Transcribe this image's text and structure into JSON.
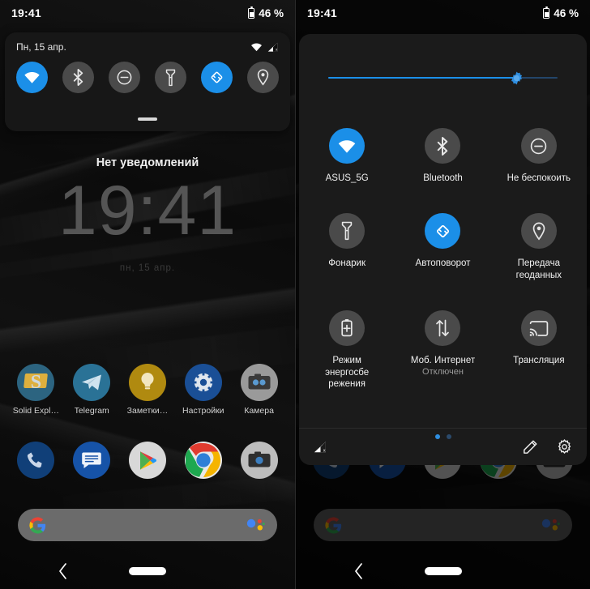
{
  "meta": {
    "os": "Android",
    "screen_title": "Android quick settings — collapsed (left) and expanded (right)",
    "accent_color": "#1b8fe8",
    "tile_off_color": "#4a4a4a",
    "panel_bg": "#1b1b1b"
  },
  "status_bar": {
    "time": "19:41",
    "battery_percent": "46 %",
    "battery_icon": "battery-icon"
  },
  "left_panel": {
    "shade": {
      "date": "Пн, 15 апр.",
      "wifi_icon": "wifi-icon",
      "signal_icon": "cellular-signal-off-icon",
      "handle": "drag-handle",
      "quick_tiles": [
        {
          "name": "wifi",
          "icon": "wifi-icon",
          "state": "on"
        },
        {
          "name": "bluetooth",
          "icon": "bluetooth-icon",
          "state": "off"
        },
        {
          "name": "do-not-disturb",
          "icon": "do-not-disturb-icon",
          "state": "off"
        },
        {
          "name": "flashlight",
          "icon": "flashlight-icon",
          "state": "off"
        },
        {
          "name": "auto-rotate",
          "icon": "auto-rotate-icon",
          "state": "on"
        },
        {
          "name": "location",
          "icon": "location-pin-icon",
          "state": "off"
        }
      ]
    },
    "lockscreen": {
      "no_notifications": "Нет уведомлений",
      "clock": "19:41",
      "date": "пн, 15 апр."
    },
    "home": {
      "apps_row1": [
        {
          "label": "Solid Expl…",
          "icon": "solid-explorer-icon"
        },
        {
          "label": "Telegram",
          "icon": "telegram-icon"
        },
        {
          "label": "Заметки…",
          "icon": "keep-notes-icon"
        },
        {
          "label": "Настройки",
          "icon": "settings-icon"
        },
        {
          "label": "Камера",
          "icon": "camera-icon"
        }
      ],
      "apps_row2": [
        {
          "label": "",
          "icon": "phone-icon"
        },
        {
          "label": "",
          "icon": "messages-icon"
        },
        {
          "label": "",
          "icon": "play-store-icon"
        },
        {
          "label": "",
          "icon": "chrome-icon"
        },
        {
          "label": "",
          "icon": "camera-icon"
        }
      ],
      "search": {
        "placeholder": "",
        "left_icon": "google-g-icon",
        "right_icon": "google-assistant-icon"
      }
    },
    "nav_bar": {
      "back_icon": "back-chevron-icon",
      "home_icon": "home-pill-icon"
    }
  },
  "right_panel": {
    "brightness": {
      "name": "brightness-slider",
      "value_percent": 82,
      "thumb_icon": "brightness-sun-icon"
    },
    "tiles": [
      {
        "label": "ASUS_5G",
        "sub": "",
        "icon": "wifi-icon",
        "state": "on"
      },
      {
        "label": "Bluetooth",
        "sub": "",
        "icon": "bluetooth-icon",
        "state": "off"
      },
      {
        "label": "Не беспокоить",
        "sub": "",
        "icon": "do-not-disturb-icon",
        "state": "off"
      },
      {
        "label": "Фонарик",
        "sub": "",
        "icon": "flashlight-icon",
        "state": "off"
      },
      {
        "label": "Автоповорот",
        "sub": "",
        "icon": "auto-rotate-icon",
        "state": "on"
      },
      {
        "label": "Передача геоданных",
        "sub": "",
        "icon": "location-pin-icon",
        "state": "off"
      },
      {
        "label": "Режим энергосбе режения",
        "sub": "",
        "icon": "battery-saver-icon",
        "state": "off"
      },
      {
        "label": "Моб. Интернет",
        "sub": "Отключен",
        "icon": "mobile-data-icon",
        "state": "off"
      },
      {
        "label": "Трансляция",
        "sub": "",
        "icon": "cast-icon",
        "state": "off"
      }
    ],
    "pagination": {
      "pages": 2,
      "current": 1
    },
    "footer": {
      "signal_icon": "cellular-signal-off-icon",
      "edit_icon": "pencil-edit-icon",
      "settings_icon": "gear-icon"
    },
    "nav_bar": {
      "back_icon": "back-chevron-icon",
      "home_icon": "home-pill-icon"
    }
  }
}
